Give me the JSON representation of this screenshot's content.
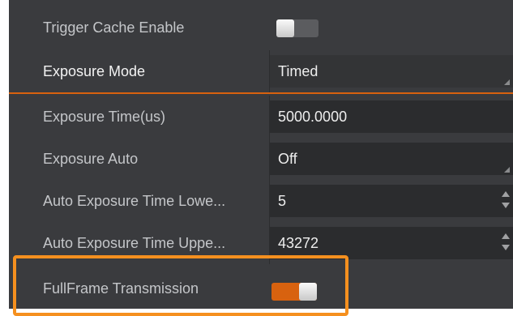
{
  "properties": [
    {
      "label": "Trigger Cache Enable",
      "kind": "toggle",
      "state": "off"
    },
    {
      "label": "Exposure Mode",
      "kind": "dropdown",
      "value": "Timed",
      "selected": true
    },
    {
      "label": "Exposure Time(us)",
      "kind": "text",
      "value": "5000.0000"
    },
    {
      "label": "Exposure Auto",
      "kind": "dropdown",
      "value": "Off"
    },
    {
      "label": "Auto Exposure Time Lowe...",
      "kind": "spinbox",
      "value": "5"
    },
    {
      "label": "Auto Exposure Time Uppe...",
      "kind": "spinbox",
      "value": "43272"
    },
    {
      "label": "FullFrame Transmission",
      "kind": "toggle",
      "state": "on",
      "highlighted": true
    }
  ],
  "colors": {
    "panel_background": "#3a3b3e",
    "value_cell": "#2b2c2e",
    "accent_orange": "#d8620f",
    "highlight_outline": "#f5901f",
    "toggle_off_track": "#5b5c5f"
  }
}
